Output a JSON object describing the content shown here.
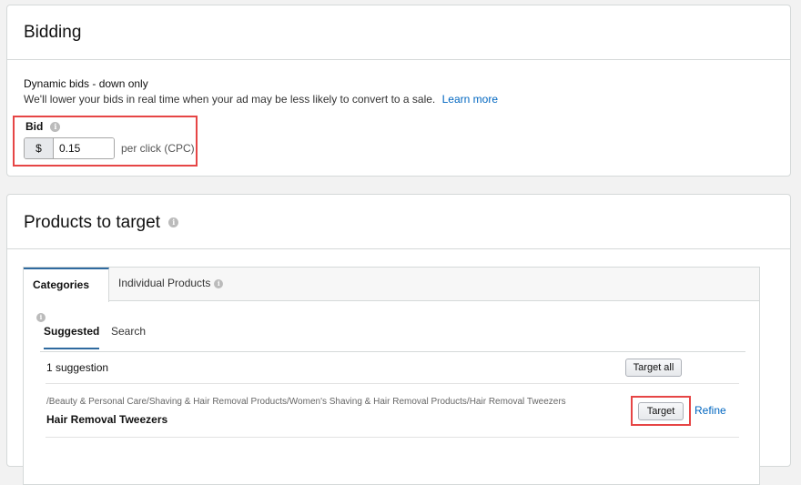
{
  "bidding": {
    "title": "Bidding",
    "strategy_title": "Dynamic bids - down only",
    "strategy_description": "We'll lower your bids in real time when your ad may be less likely to convert to a sale.",
    "learn_more": "Learn more",
    "bid_label": "Bid",
    "currency": "$",
    "bid_value": "0.15",
    "bid_suffix": "per click (CPC)"
  },
  "products": {
    "title": "Products to target",
    "tabs": [
      {
        "label": "Categories"
      },
      {
        "label": "Individual Products"
      }
    ],
    "subtabs": [
      {
        "label": "Suggested"
      },
      {
        "label": "Search"
      }
    ],
    "suggestion_count": "1 suggestion",
    "target_all_label": "Target all",
    "suggestions": [
      {
        "path": "/Beauty & Personal Care/Shaving & Hair Removal Products/Women's Shaving & Hair Removal Products/Hair Removal Tweezers",
        "name": "Hair Removal Tweezers",
        "target_label": "Target",
        "refine_label": "Refine"
      }
    ]
  },
  "icons": {
    "info": "info-icon"
  },
  "colors": {
    "link": "#0066c0",
    "highlight": "#e64545",
    "active_tab": "#2f6a9f"
  }
}
